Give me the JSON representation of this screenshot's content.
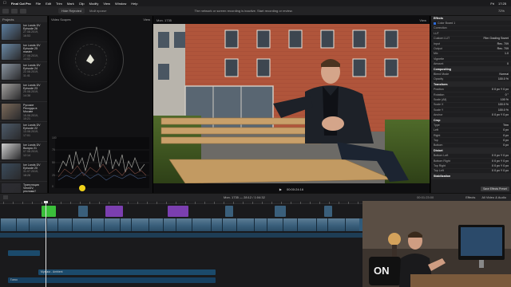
{
  "menubar": {
    "apple": "",
    "app": "Final Cut Pro",
    "items": [
      "File",
      "Edit",
      "Trim",
      "Mark",
      "Clip",
      "Modify",
      "View",
      "Window",
      "Help"
    ],
    "status": [
      "Fri",
      "17:25"
    ]
  },
  "toolbar": {
    "filter": "Hide Rejected",
    "library": "Мой проект",
    "background_msg": "The network or screen recording is inactive. Start recording or review.",
    "zoom": "72%",
    "view": "View"
  },
  "browser": {
    "header": "Projects",
    "clips": [
      {
        "title": "Ice Lands DV",
        "sub": "Episode 26",
        "date": "27.08.2019, 16:53",
        "color": "#5d7fa0"
      },
      {
        "title": "Ice Lands DV",
        "sub": "Episode 25 master",
        "date": "27.08.2019, 14:02",
        "color": "#6b8aa6"
      },
      {
        "title": "Ice Lands DV",
        "sub": "Episode 24",
        "date": "22.08.2019, 11:41",
        "color": "#8b96a2"
      },
      {
        "title": "Ice Lands DV",
        "sub": "Episode 23",
        "date": "20.08.2019, 14:38",
        "color": "#a4a2a0"
      },
      {
        "title": "Русские Рекорды в",
        "sub": "Москве",
        "date": "15.08.2019, 10:21",
        "color": "#7c6a5a"
      },
      {
        "title": "Ice Lands DV",
        "sub": "Episode 22",
        "date": "13.08.2019, 17:01",
        "color": "#4d5b6a"
      },
      {
        "title": "Ice Lands DV",
        "sub": "Выпуск 21",
        "date": "07.08.2019, 12:14",
        "color": "#cfcfcf"
      },
      {
        "title": "Ice Lands DV",
        "sub": "Episode 20",
        "date": "31.07.2019, 18:28",
        "color": "#3b4c5c"
      },
      {
        "title": "Трансляция",
        "sub": "ViewDV, реклама?",
        "date": "25.07.2019, 09:47",
        "color": "#2d2d33"
      }
    ]
  },
  "scopes": {
    "title": "Video Scopes",
    "view": "View",
    "wave_labels": [
      "100",
      "75",
      "50",
      "25",
      "0"
    ]
  },
  "viewer": {
    "title": "Mon. 1735",
    "view": "View",
    "timecode": "00:00:24:16",
    "play": "▶"
  },
  "inspector": {
    "rows": [
      {
        "type": "section",
        "label": "Effects"
      },
      {
        "type": "row",
        "label": "Color Board 1",
        "value": "",
        "check": true
      },
      {
        "type": "row",
        "label": "Correction",
        "value": ""
      },
      {
        "type": "row",
        "label": "LUT",
        "value": ""
      },
      {
        "type": "row",
        "label": "Custom LUT",
        "value": "Film Grading Sweet"
      },
      {
        "type": "row",
        "label": "Input",
        "value": "Rec. 709"
      },
      {
        "type": "row",
        "label": "Output",
        "value": "Rec. 709"
      },
      {
        "type": "row",
        "label": "Mix",
        "value": "1.0"
      },
      {
        "type": "row",
        "label": "Vignette",
        "value": ""
      },
      {
        "type": "row",
        "label": "Amount",
        "value": "0"
      },
      {
        "type": "section",
        "label": "Compositing"
      },
      {
        "type": "row",
        "label": "Blend Mode",
        "value": "Normal"
      },
      {
        "type": "row",
        "label": "Opacity",
        "value": "100.0 %"
      },
      {
        "type": "section",
        "label": "Transform"
      },
      {
        "type": "row",
        "label": "Position",
        "value": "X 0 px  Y 0 px"
      },
      {
        "type": "row",
        "label": "Rotation",
        "value": "0 °"
      },
      {
        "type": "row",
        "label": "Scale (All)",
        "value": "100 %"
      },
      {
        "type": "row",
        "label": "Scale X",
        "value": "100.0 %"
      },
      {
        "type": "row",
        "label": "Scale Y",
        "value": "100.0 %"
      },
      {
        "type": "row",
        "label": "Anchor",
        "value": "X 0 px  Y 0 px"
      },
      {
        "type": "section",
        "label": "Crop"
      },
      {
        "type": "row",
        "label": "Type",
        "value": "Trim"
      },
      {
        "type": "row",
        "label": "Left",
        "value": "0 px"
      },
      {
        "type": "row",
        "label": "Right",
        "value": "0 px"
      },
      {
        "type": "row",
        "label": "Top",
        "value": "0 px"
      },
      {
        "type": "row",
        "label": "Bottom",
        "value": "0 px"
      },
      {
        "type": "section",
        "label": "Distort"
      },
      {
        "type": "row",
        "label": "Bottom Left",
        "value": "X 0 px  Y 0 px"
      },
      {
        "type": "row",
        "label": "Bottom Right",
        "value": "X 0 px  Y 0 px"
      },
      {
        "type": "row",
        "label": "Top Right",
        "value": "X 0 px  Y 0 px"
      },
      {
        "type": "row",
        "label": "Top Left",
        "value": "X 0 px  Y 0 px"
      },
      {
        "type": "section",
        "label": "Stabilization"
      }
    ],
    "save_button": "Save Effects Preset"
  },
  "timeline_bar": {
    "roles": "Mon. 1735 — 28:12 / 1:04:32",
    "timecode": "00:01:23:00",
    "effects": "Effects",
    "installed": "All Video & Audio"
  },
  "timeline": {
    "audio_labels": [
      "Музыка - Ambient",
      "Голос"
    ]
  },
  "colors": {
    "accent": "#2d6bd8",
    "clip_blue": "#3a5f7b",
    "clip_green": "#3bbf3b",
    "clip_purple": "#7b3fb0",
    "audio": "#1b4a6b",
    "playhead_cursor": "#f0d21a"
  }
}
